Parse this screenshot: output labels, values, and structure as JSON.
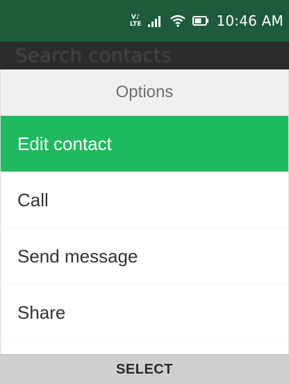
{
  "status_bar": {
    "volte_top": "V♪",
    "volte_bottom": "LTE",
    "time": "10:46 AM",
    "icons": [
      "volte-lte-icon",
      "signal-icon",
      "wifi-icon",
      "battery-icon"
    ]
  },
  "background_screen": {
    "search_placeholder": "Search contacts"
  },
  "options_menu": {
    "title": "Options",
    "items": [
      {
        "label": "Edit contact",
        "selected": true
      },
      {
        "label": "Call",
        "selected": false
      },
      {
        "label": "Send message",
        "selected": false
      },
      {
        "label": "Share",
        "selected": false
      }
    ]
  },
  "softkeys": {
    "center": "SELECT"
  },
  "colors": {
    "status_bar": "#1d5b3a",
    "accent": "#1fba5f",
    "softkey_bar": "#cfcfcf"
  }
}
